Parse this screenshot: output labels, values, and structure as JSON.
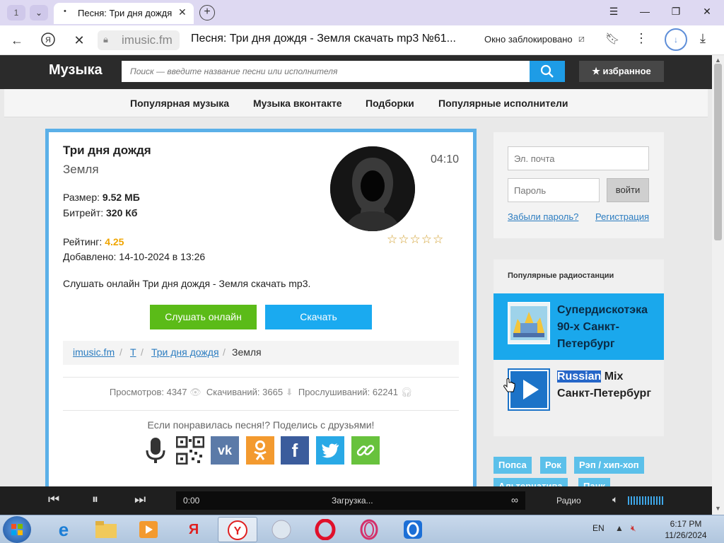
{
  "browser": {
    "tab_count": "1",
    "tab_title": "Песня: Три дня дождя",
    "url_domain": "imusic.fm",
    "page_title": "Песня: Три дня дождя - Земля скачать mp3 №61...",
    "popup_blocked": "Окно заблокировано"
  },
  "site": {
    "logo": "Музыка",
    "search_placeholder": "Поиск — введите название песни или исполнителя",
    "favorites_label": "избранное",
    "nav": [
      "Популярная музыка",
      "Музыка вконтакте",
      "Подборки",
      "Популярные исполнители"
    ]
  },
  "song": {
    "title": "Три дня дождя",
    "artist": "Земля",
    "duration": "04:10",
    "size_label": "Размер:",
    "size_value": "9.52 МБ",
    "bitrate_label": "Битрейт:",
    "bitrate_value": "320 Кб",
    "rating_label": "Рейтинг:",
    "rating_value": "4.25",
    "added": "Добавлено: 14-10-2024 в 13:26",
    "listen_text": "Слушать онлайн Три дня дождя - Земля скачать mp3.",
    "listen_button": "Слушать онлайн",
    "download_button": "Скачать",
    "breadcrumb": [
      "imusic.fm",
      "Т",
      "Три дня дождя",
      "Земля"
    ],
    "stats": {
      "views_label": "Просмотров: 4347",
      "downloads_label": "Скачиваний: 3665",
      "plays_label": "Прослушиваний: 62241"
    },
    "share_text": "Если понравилась песня!? Поделись с друзьями!"
  },
  "login": {
    "email_placeholder": "Эл. почта",
    "password_placeholder": "Пароль",
    "login_button": "войти",
    "forgot": "Забыли пароль?",
    "register": "Регистрация"
  },
  "radio": {
    "heading": "Популярные радиостанции",
    "stations": [
      {
        "name": "Супердискотэка 90-х Санкт-Петербург"
      },
      {
        "name_highlight": "Russian",
        "name_rest": " Mix Санкт-Петербург"
      }
    ]
  },
  "tags": [
    "Попса",
    "Рок",
    "Рэп / хип-хоп",
    "Альтернатива",
    "Панк"
  ],
  "player": {
    "time": "0:00",
    "status": "Загрузка...",
    "infinity": "∞",
    "radio": "Радио"
  },
  "taskbar": {
    "lang": "EN",
    "time": "6:17 PM",
    "date": "11/26/2024"
  },
  "colors": {
    "accent_blue": "#1aaaf0",
    "listen_green": "#5bbb18",
    "header_dark": "#2b2b2b",
    "rating_orange": "#f0a500"
  }
}
